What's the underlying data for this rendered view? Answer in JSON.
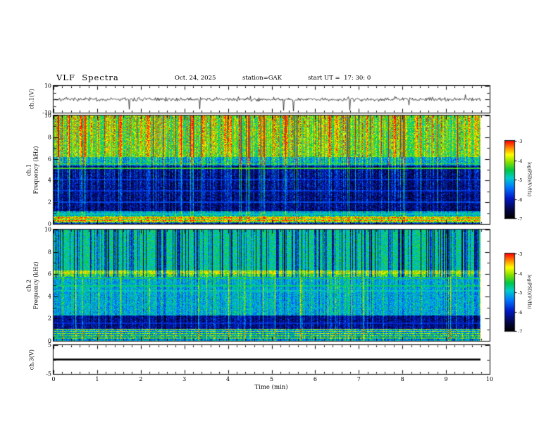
{
  "header": {
    "title": "VLF  Spectra",
    "date": "Oct. 24, 2025",
    "station": "station=GAK",
    "start_ut": "start UT =  17: 30: 0"
  },
  "xaxis": {
    "label": "Time (min)",
    "lim": [
      0,
      10
    ],
    "ticks": [
      0,
      1,
      2,
      3,
      4,
      5,
      6,
      7,
      8,
      9,
      10
    ],
    "minor_step": 0.2,
    "data_end": 9.8
  },
  "colormap": {
    "zlim": [
      -7,
      -3
    ],
    "stops": [
      [
        0.0,
        0,
        0,
        0
      ],
      [
        0.1,
        5,
        5,
        60
      ],
      [
        0.26,
        0,
        25,
        200
      ],
      [
        0.4,
        0,
        120,
        255
      ],
      [
        0.52,
        0,
        205,
        205
      ],
      [
        0.62,
        0,
        200,
        70
      ],
      [
        0.72,
        130,
        225,
        0
      ],
      [
        0.82,
        255,
        255,
        0
      ],
      [
        0.9,
        255,
        150,
        0
      ],
      [
        1.0,
        255,
        0,
        0
      ]
    ]
  },
  "chart_data": [
    {
      "type": "line",
      "name": "ch1-waveform",
      "ylabel": "ch.1(V)",
      "ylim": [
        -10,
        10
      ],
      "ytick_labels": [
        10,
        -10
      ],
      "yticks_major": [
        10,
        0,
        -10
      ],
      "yticks_minor": [
        5,
        -5
      ],
      "line_color": "#000000",
      "description": "broadband noise of about ±2 V with frequent impulsive sferic spikes reaching -10 V",
      "seed": 7,
      "noise_sigma": 0.8,
      "neg_spike_prob": 0.012,
      "pos_spike_prob": 0.006,
      "neg_spike_max": 9,
      "pos_spike_max": 4.5
    },
    {
      "type": "heatmap",
      "name": "ch1-spectrogram",
      "ylabel_lines": [
        "ch.1",
        "Frequency (kHz)"
      ],
      "ylim": [
        0,
        10
      ],
      "ytick_labels": [
        10,
        8,
        6,
        4,
        2,
        0
      ],
      "yticks_major": [
        0,
        2,
        4,
        6,
        8,
        10
      ],
      "yticks_minor": [
        1,
        3,
        5,
        7,
        9
      ],
      "zlim": [
        -7,
        -3
      ],
      "colorbar": {
        "ticks": [
          -3,
          -4,
          -5,
          -6,
          -7
        ],
        "label": "log(PSD)(V²/Hz)"
      },
      "seed": 42,
      "noise": 1.1,
      "bands": [
        {
          "f": [
            0,
            0.15
          ],
          "level": -6.1
        },
        {
          "f": [
            0.15,
            0.72
          ],
          "level": -4.0
        },
        {
          "f": [
            0.72,
            1.15
          ],
          "level": -5.3
        },
        {
          "f": [
            1.15,
            5.4
          ],
          "level": -6.55
        },
        {
          "f": [
            5.4,
            6.2
          ],
          "level": -5.4
        },
        {
          "f": [
            6.2,
            10.01
          ],
          "level": -4.6
        }
      ],
      "row_mod": {
        "f": [
          0.15,
          0.72
        ],
        "amp": 0.55,
        "freq": 4
      },
      "hlines": [
        {
          "f": 0.9,
          "level": -4.9
        },
        {
          "f": 2.0,
          "level": -5.7
        },
        {
          "f": 3.05,
          "level": -5.85
        },
        {
          "f": 4.1,
          "level": -5.85
        },
        {
          "f": 5.15,
          "level": -4.35
        },
        {
          "f": 5.55,
          "level": -4.35
        }
      ],
      "streaks": {
        "strong_prob": 0.09,
        "prob": 0.52,
        "bright_profile": [
          {
            "f": [
              0,
              10.01
            ],
            "wlo": 0.35,
            "whi": 1.15
          }
        ],
        "dark_prob": 0,
        "dark_profile": []
      }
    },
    {
      "type": "heatmap",
      "name": "ch2-spectrogram",
      "ylabel_lines": [
        "ch.2",
        "Frequency (kHz)"
      ],
      "ylim": [
        0,
        10
      ],
      "ytick_labels": [
        10,
        8,
        6,
        4,
        2,
        0
      ],
      "yticks_major": [
        0,
        2,
        4,
        6,
        8,
        10
      ],
      "yticks_minor": [
        1,
        3,
        5,
        7,
        9
      ],
      "zlim": [
        -7,
        -3
      ],
      "colorbar": {
        "ticks": [
          -3,
          -4,
          -5,
          -6,
          -7
        ],
        "label": "log(PSD)(V²/Hz)"
      },
      "seed": 77,
      "noise": 0.95,
      "bands": [
        {
          "f": [
            0,
            0.12
          ],
          "level": -5.3
        },
        {
          "f": [
            0.12,
            1.05
          ],
          "level": -5.0
        },
        {
          "f": [
            1.05,
            2.3
          ],
          "level": -6.3
        },
        {
          "f": [
            2.3,
            5.75
          ],
          "level": -5.15
        },
        {
          "f": [
            5.75,
            6.0
          ],
          "level": -4.3
        },
        {
          "f": [
            6.0,
            6.35
          ],
          "level": -3.85
        },
        {
          "f": [
            6.35,
            10.01
          ],
          "level": -4.75
        }
      ],
      "row_mod": {
        "f": [
          0.12,
          1.05
        ],
        "amp": 0.8,
        "freq": 5
      },
      "hlines": [
        {
          "f": 1.6,
          "level": -5.9
        },
        {
          "f": 4.5,
          "level": -5.0
        },
        {
          "f": 4.95,
          "level": -4.7
        },
        {
          "f": 5.6,
          "level": -4.5
        }
      ],
      "streaks": {
        "strong_prob": 0.05,
        "prob": 0.35,
        "bright_profile": [
          {
            "f": [
              0,
              5.75
            ],
            "wlo": 0.45,
            "whi": 0.45
          }
        ],
        "dark_prob": 0.3,
        "dark_profile": [
          {
            "f": [
              5.75,
              10.01
            ],
            "w": 1.0
          },
          {
            "f": [
              1.05,
              5.75
            ],
            "w": 0.25
          }
        ]
      }
    },
    {
      "type": "line",
      "name": "ch3-waveform",
      "ylabel": "ch.3(V)",
      "ylim": [
        -5,
        5
      ],
      "ytick_labels": [
        5,
        -5
      ],
      "yticks_major": [
        5,
        -5
      ],
      "yticks_minor": [
        0
      ],
      "line_color": "#000000",
      "flat_value": 0,
      "description": "constant 0 V trace from 0 to 9.8 min",
      "seed": 3
    }
  ]
}
